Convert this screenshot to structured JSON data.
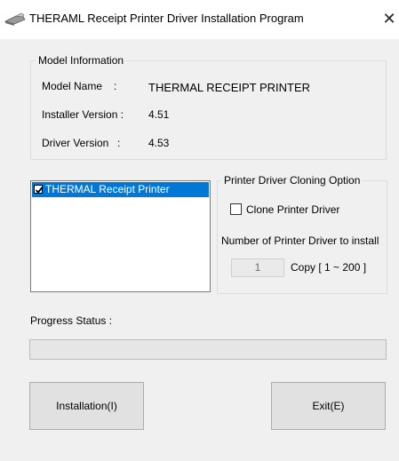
{
  "window": {
    "title": "THERAML Receipt Printer Driver Installation Program",
    "close_glyph": "✕"
  },
  "model_info": {
    "group_title": "Model Information",
    "model_name_label": "Model Name",
    "model_name_colon": ":",
    "model_name_value": "THERMAL RECEIPT PRINTER",
    "installer_version_label": "Installer Version :",
    "installer_version_value": "4.51",
    "driver_version_label": "Driver Version",
    "driver_version_colon": ":",
    "driver_version_value": "4.53"
  },
  "printer_list": {
    "items": [
      {
        "label": "THERMAL Receipt Printer",
        "checked": true,
        "selected": true
      }
    ]
  },
  "cloning": {
    "group_title": "Printer Driver Cloning Option",
    "clone_checkbox_label": "Clone Printer Driver",
    "clone_checked": false,
    "count_label": "Number of Printer Driver to install",
    "copy_value": "1",
    "copy_range_label": "Copy [ 1 ~ 200 ]"
  },
  "progress": {
    "label": "Progress Status :",
    "fraction": 0
  },
  "buttons": {
    "install_label": "Installation(I)",
    "exit_label": "Exit(E)"
  },
  "icons": {
    "title_icon": "printer-driver-icon",
    "close_icon": "close-icon",
    "check_icon": "checkmark-icon"
  },
  "colors": {
    "selection": "#0078d7",
    "window_bg": "#f0f0f0",
    "button_bg": "#e1e1e1"
  }
}
